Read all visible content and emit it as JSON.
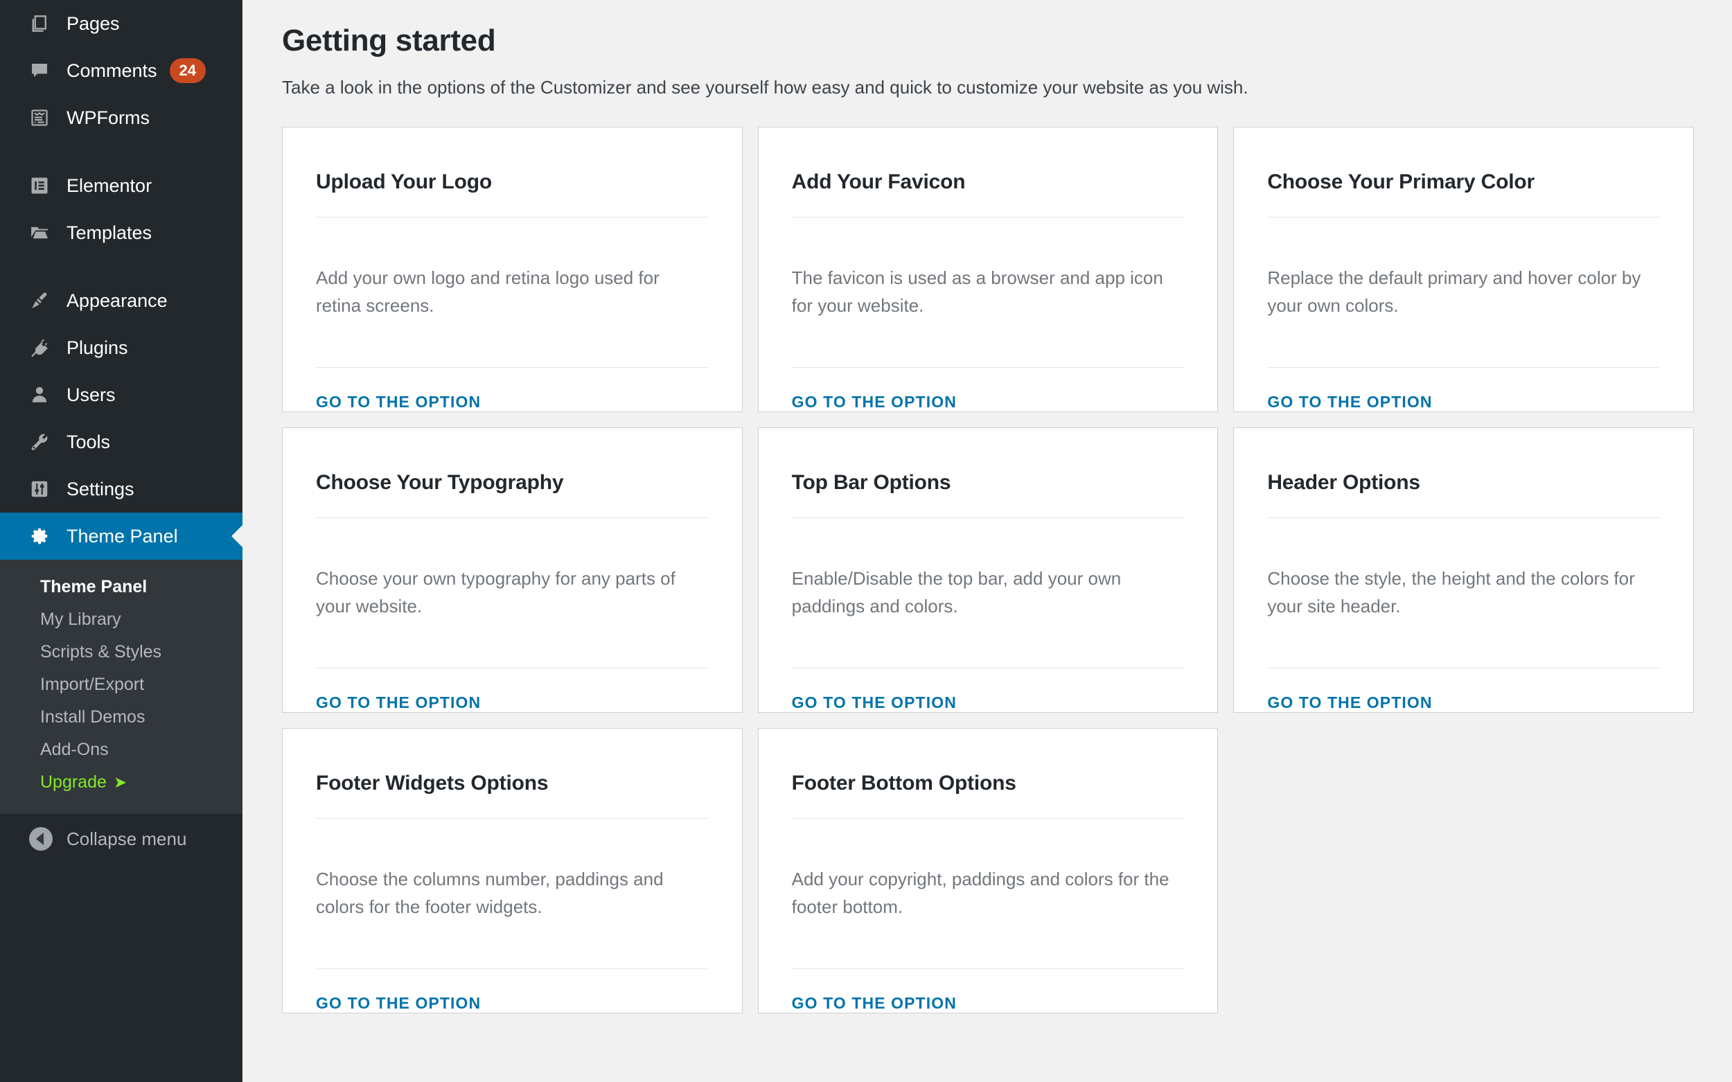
{
  "sidebar": {
    "items": [
      {
        "label": "Pages",
        "icon": "pages-icon",
        "badge": null,
        "gap_after": false
      },
      {
        "label": "Comments",
        "icon": "comments-icon",
        "badge": "24",
        "gap_after": false
      },
      {
        "label": "WPForms",
        "icon": "wpforms-icon",
        "badge": null,
        "gap_after": true
      },
      {
        "label": "Elementor",
        "icon": "elementor-icon",
        "badge": null,
        "gap_after": false
      },
      {
        "label": "Templates",
        "icon": "templates-icon",
        "badge": null,
        "gap_after": true
      },
      {
        "label": "Appearance",
        "icon": "appearance-icon",
        "badge": null,
        "gap_after": false
      },
      {
        "label": "Plugins",
        "icon": "plugins-icon",
        "badge": null,
        "gap_after": false
      },
      {
        "label": "Users",
        "icon": "users-icon",
        "badge": null,
        "gap_after": false
      },
      {
        "label": "Tools",
        "icon": "tools-icon",
        "badge": null,
        "gap_after": false
      },
      {
        "label": "Settings",
        "icon": "settings-icon",
        "badge": null,
        "gap_after": false
      }
    ],
    "active_item": {
      "label": "Theme Panel",
      "icon": "gear-icon"
    },
    "submenu": [
      {
        "label": "Theme Panel",
        "state": "current"
      },
      {
        "label": "My Library",
        "state": "normal"
      },
      {
        "label": "Scripts & Styles",
        "state": "normal"
      },
      {
        "label": "Import/Export",
        "state": "normal"
      },
      {
        "label": "Install Demos",
        "state": "normal"
      },
      {
        "label": "Add-Ons",
        "state": "normal"
      },
      {
        "label": "Upgrade",
        "state": "upgrade",
        "arrow": "➤"
      }
    ],
    "collapse": {
      "label": "Collapse menu",
      "icon": "collapse-left-icon"
    },
    "colors": {
      "background": "#23282d",
      "submenu_background": "#32373c",
      "active": "#0073aa",
      "badge": "#ca4a1f",
      "upgrade": "#83e825"
    }
  },
  "main": {
    "title": "Getting started",
    "subtitle": "Take a look in the options of the Customizer and see yourself how easy and quick to customize your website as you wish.",
    "link_label": "GO TO THE OPTION",
    "accent_color": "#0073aa",
    "cards": [
      {
        "title": "Upload Your Logo",
        "body": "Add your own logo and retina logo used for retina screens.",
        "link": "GO TO THE OPTION"
      },
      {
        "title": "Add Your Favicon",
        "body": "The favicon is used as a browser and app icon for your website.",
        "link": "GO TO THE OPTION"
      },
      {
        "title": "Choose Your Primary Color",
        "body": "Replace the default primary and hover color by your own colors.",
        "link": "GO TO THE OPTION"
      },
      {
        "title": "Choose Your Typography",
        "body": "Choose your own typography for any parts of your website.",
        "link": "GO TO THE OPTION"
      },
      {
        "title": "Top Bar Options",
        "body": "Enable/Disable the top bar, add your own paddings and colors.",
        "link": "GO TO THE OPTION"
      },
      {
        "title": "Header Options",
        "body": "Choose the style, the height and the colors for your site header.",
        "link": "GO TO THE OPTION"
      },
      {
        "title": "Footer Widgets Options",
        "body": "Choose the columns number, paddings and colors for the footer widgets.",
        "link": "GO TO THE OPTION"
      },
      {
        "title": "Footer Bottom Options",
        "body": "Add your copyright, paddings and colors for the footer bottom.",
        "link": "GO TO THE OPTION"
      }
    ]
  }
}
